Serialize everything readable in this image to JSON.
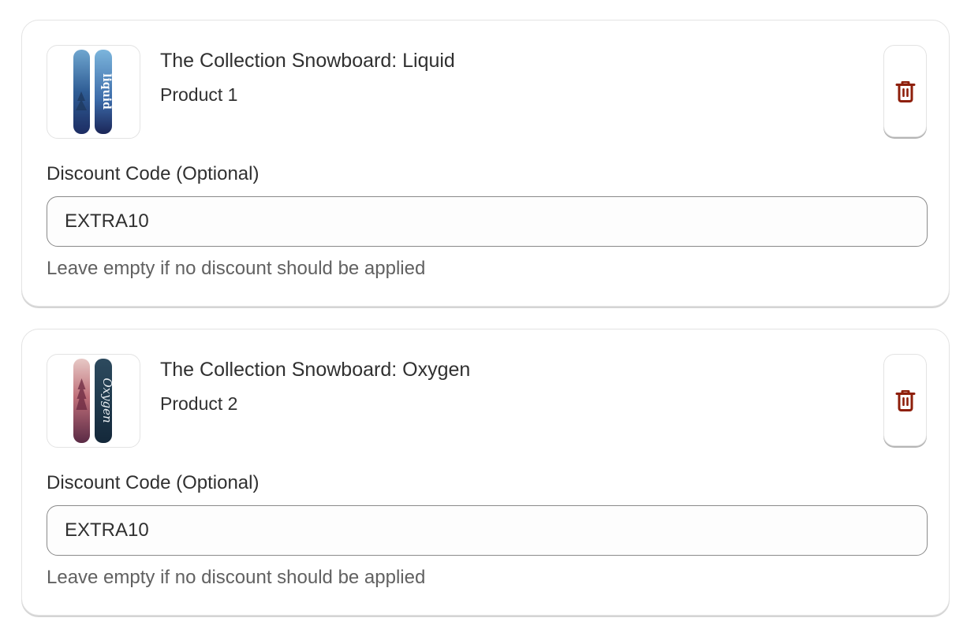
{
  "products": [
    {
      "title": "The Collection Snowboard: Liquid",
      "subtitle": "Product 1",
      "discount_label": "Discount Code (Optional)",
      "discount_value": "EXTRA10",
      "help_text": "Leave empty if no discount should be applied",
      "delete_icon": "trash-icon",
      "image_icon": "snowboard-liquid-image"
    },
    {
      "title": "The Collection Snowboard: Oxygen",
      "subtitle": "Product 2",
      "discount_label": "Discount Code (Optional)",
      "discount_value": "EXTRA10",
      "help_text": "Leave empty if no discount should be applied",
      "delete_icon": "trash-icon",
      "image_icon": "snowboard-oxygen-image"
    }
  ],
  "colors": {
    "delete_icon": "#8e1f0b",
    "border": "#e3e3e3",
    "input_border": "#8a8a8a",
    "help_text": "#616161"
  }
}
